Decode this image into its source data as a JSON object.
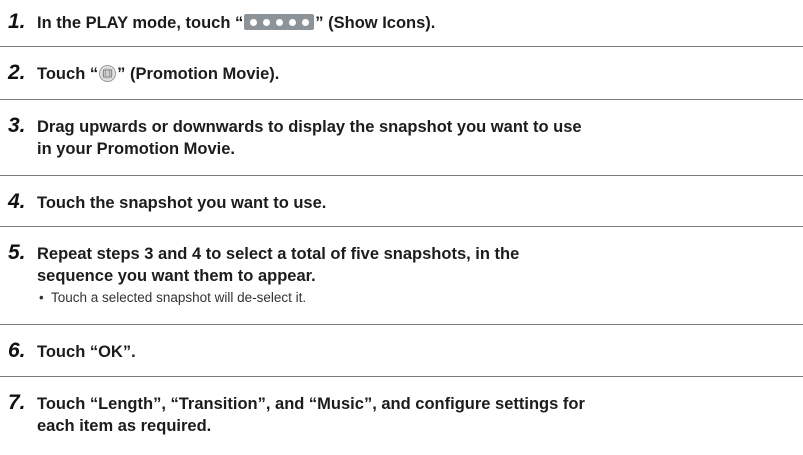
{
  "steps": [
    {
      "number": "1.",
      "before": "In the PLAY mode, touch “",
      "icon": "show-icons-icon",
      "after": "” (Show Icons)."
    },
    {
      "number": "2.",
      "before": "Touch “",
      "icon": "promotion-movie-icon",
      "after": "” (Promotion Movie)."
    },
    {
      "number": "3.",
      "line1": "Drag upwards or downwards to display the snapshot you want to use",
      "line2": "in your Promotion Movie."
    },
    {
      "number": "4.",
      "line1": "Touch the snapshot you want to use."
    },
    {
      "number": "5.",
      "line1": "Repeat steps 3 and 4 to select a total of five snapshots, in the",
      "line2": "sequence you want them to appear.",
      "note_bullet": "•",
      "note": "Touch a selected snapshot will de-select it."
    },
    {
      "number": "6.",
      "line1": "Touch “OK”."
    },
    {
      "number": "7.",
      "line1": "Touch “Length”, “Transition”, and “Music”, and configure settings for",
      "line2": "each item as required."
    }
  ],
  "colors": {
    "text": "#1c1c1c",
    "rule": "#7a7a7a",
    "show_icons_bg": "#8d9499"
  }
}
